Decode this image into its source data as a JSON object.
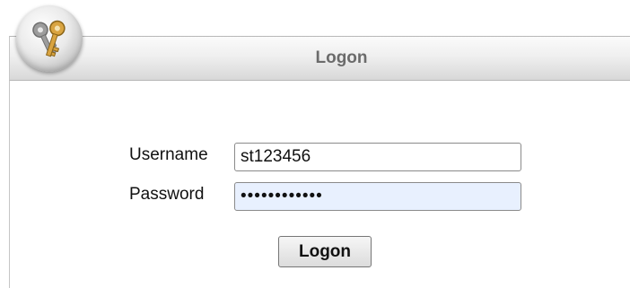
{
  "header": {
    "title": "Logon",
    "logo_icon": "keys-icon"
  },
  "form": {
    "username_label": "Username",
    "username_value": "st123456",
    "password_label": "Password",
    "password_value": "st1234567890",
    "submit_label": "Logon"
  },
  "colors": {
    "header_text": "#6b6b6b",
    "password_autofill_bg": "#e8f0fe",
    "key_gold": "#d9a441"
  }
}
